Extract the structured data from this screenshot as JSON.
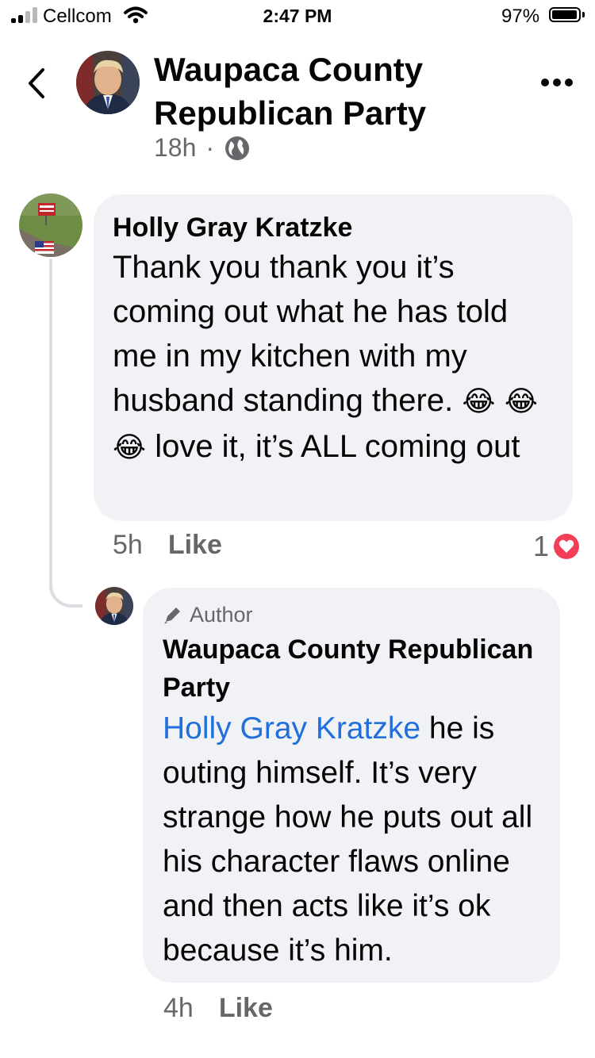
{
  "status_bar": {
    "carrier": "Cellcom",
    "time": "2:47 PM",
    "battery_percent": "97%",
    "battery_level": 0.97,
    "signal_bars": 2
  },
  "header": {
    "title": "Waupaca County Republican Party",
    "post_age": "18h",
    "separator": "·",
    "privacy_icon": "globe-icon",
    "back_icon": "chevron-left-icon",
    "more_icon": "more-horizontal-icon"
  },
  "comments": [
    {
      "author": "Holly Gray Kratzke",
      "text_before_emoji": "Thank you thank you it’s coming out what he has told me in my kitchen with my husband standing there. ",
      "emoji": "😂 😂 😂",
      "text_after_emoji": " love it, it’s ALL coming out",
      "time": "5h",
      "like_label": "Like",
      "reaction_count": "1",
      "reaction_icon": "love-heart-icon"
    },
    {
      "badge": "Author",
      "badge_icon": "pencil-icon",
      "author": "Waupaca County Republican Party",
      "mention": "Holly Gray Kratzke",
      "text": " he is outing himself.  It’s very strange how he puts out all his character flaws online and then acts like it’s ok because it’s him.",
      "time": "4h",
      "like_label": "Like"
    }
  ],
  "colors": {
    "bubble": "#f0f2f5",
    "secondary_text": "#65676b",
    "mention_link": "#216fdb",
    "love_reaction": "#f33e58"
  }
}
